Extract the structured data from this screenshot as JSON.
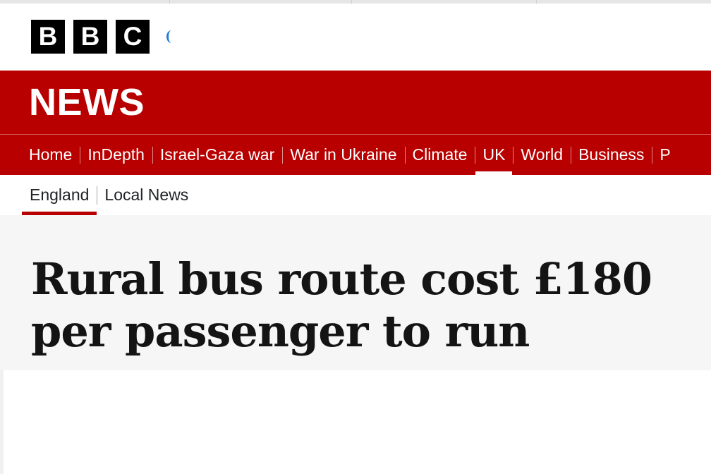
{
  "brand": {
    "logo_letters": [
      "B",
      "B",
      "C"
    ],
    "section_title": "NEWS",
    "colors": {
      "brand_red": "#b80000",
      "logo_black": "#000000",
      "headline_bg": "#f6f6f6"
    }
  },
  "nav": {
    "items": [
      {
        "label": "Home",
        "active": false
      },
      {
        "label": "InDepth",
        "active": false
      },
      {
        "label": "Israel-Gaza war",
        "active": false
      },
      {
        "label": "War in Ukraine",
        "active": false
      },
      {
        "label": "Climate",
        "active": false
      },
      {
        "label": "UK",
        "active": true
      },
      {
        "label": "World",
        "active": false
      },
      {
        "label": "Business",
        "active": false
      },
      {
        "label": "P",
        "active": false
      }
    ]
  },
  "subnav": {
    "items": [
      {
        "label": "England",
        "active": true
      },
      {
        "label": "Local News",
        "active": false
      }
    ]
  },
  "article": {
    "headline": "Rural bus route cost £180 per passenger to run"
  }
}
